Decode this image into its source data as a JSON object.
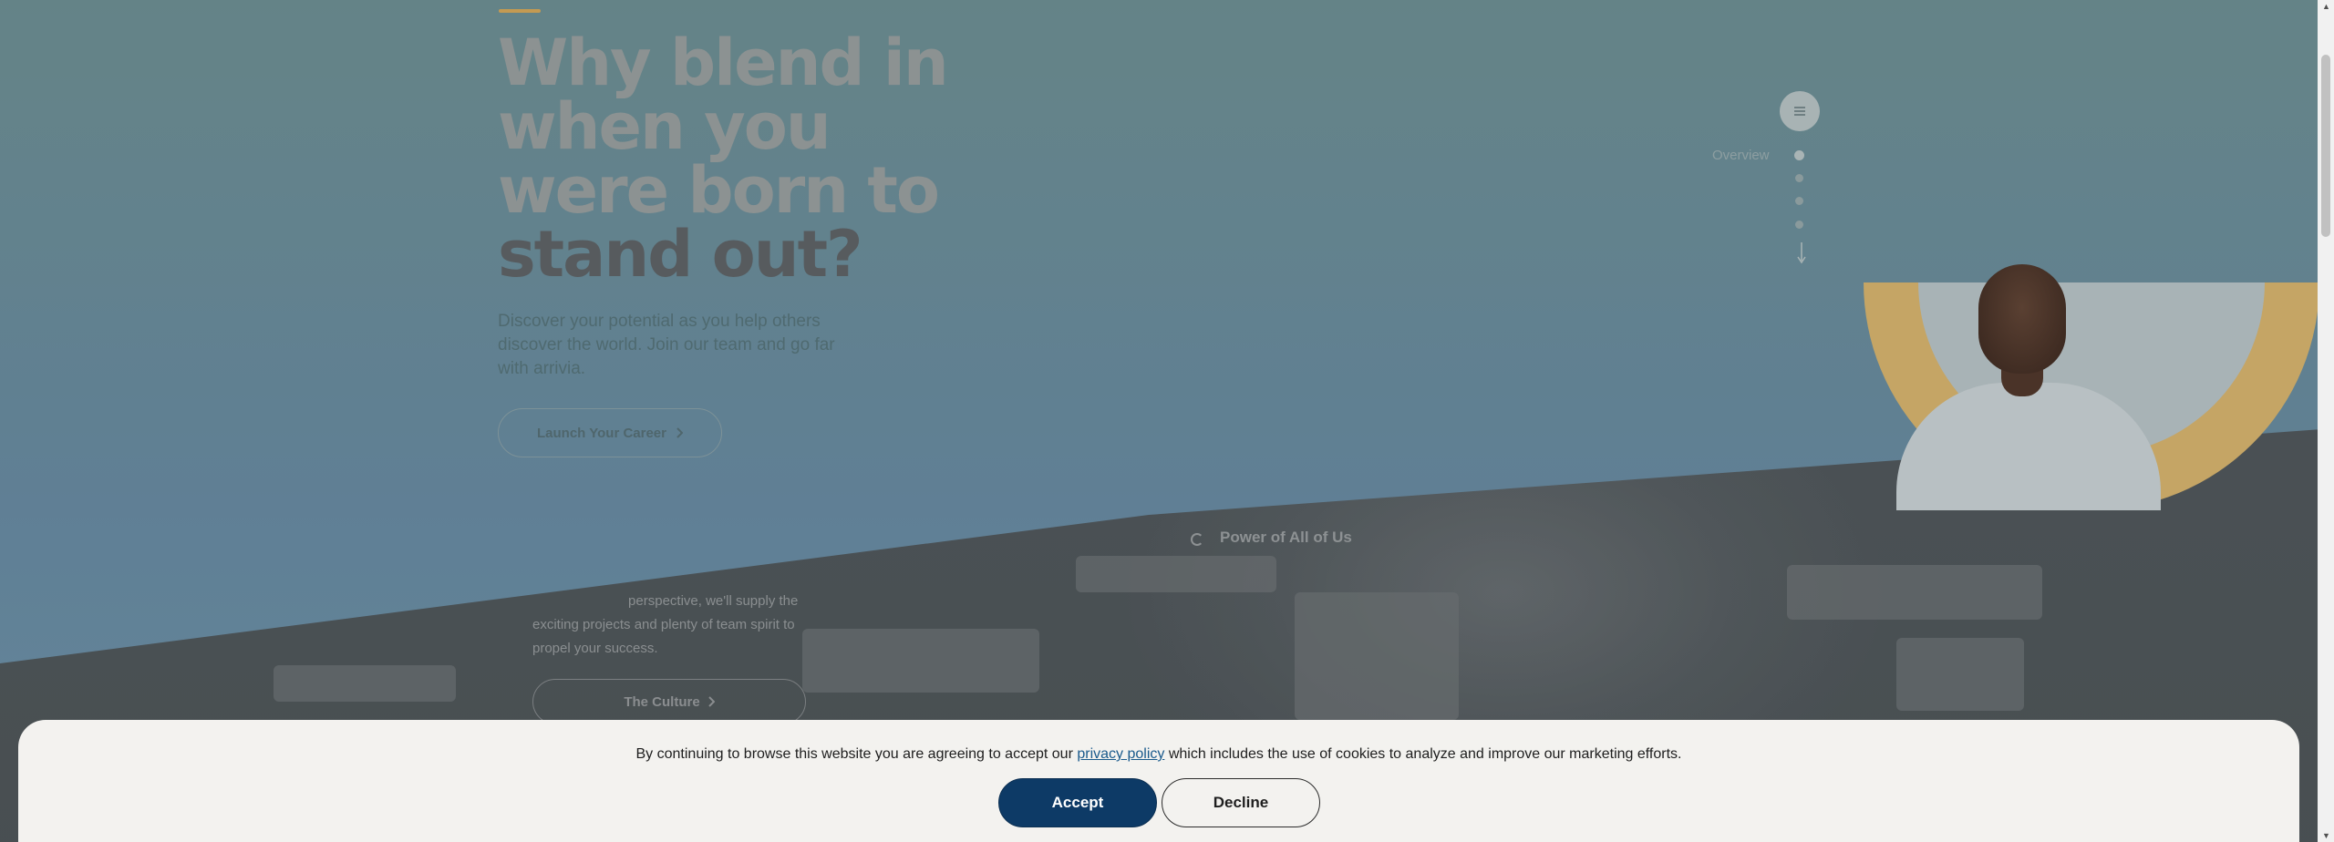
{
  "hero": {
    "headline_line1": "Why blend in",
    "headline_line2": "when you",
    "headline_line3": "were born to",
    "headline_line4": "stand out?",
    "subtext": "Discover your potential as you help others discover the world. Join our team and go far with arrivia.",
    "cta_label": "Launch Your Career",
    "cta_icon": "chevron-right-icon"
  },
  "culture": {
    "text_visible": "perspective, we'll supply the exciting projects and plenty of team spirit to propel your success.",
    "button_label": "The Culture",
    "button_icon": "chevron-right-icon"
  },
  "features": {
    "power_label": "Power of All of Us"
  },
  "side_nav": {
    "menu_icon": "menu-icon",
    "active_label": "Overview",
    "arrow_icon": "arrow-down-icon"
  },
  "cookie_banner": {
    "text_before": "By continuing to browse this website you are agreeing to accept our ",
    "link_text": "privacy policy",
    "text_after": " which includes the use of cookies to analyze and improve our marketing efforts.",
    "accept_label": "Accept",
    "decline_label": "Decline"
  },
  "colors": {
    "accent": "#c49a52",
    "accept_button": "#0d3a66",
    "banner_bg": "#f3f2ef"
  }
}
